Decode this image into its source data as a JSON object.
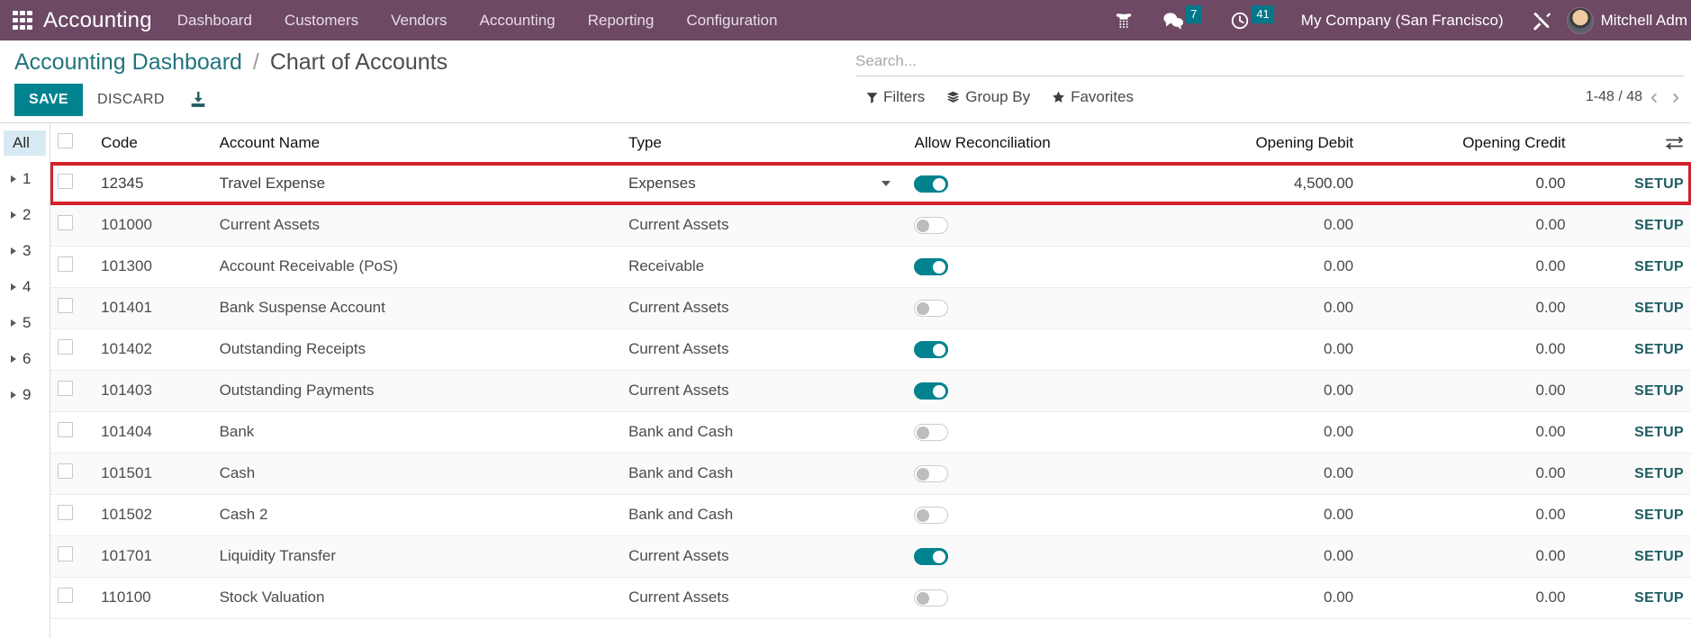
{
  "navbar": {
    "apps_icon": "apps-grid-icon",
    "brand": "Accounting",
    "menus": [
      "Dashboard",
      "Customers",
      "Vendors",
      "Accounting",
      "Reporting",
      "Configuration"
    ],
    "icons": [
      {
        "name": "voip-dialpad-icon",
        "badge": null
      },
      {
        "name": "messaging-chat-icon",
        "badge": "7"
      },
      {
        "name": "activities-clock-icon",
        "badge": "41"
      }
    ],
    "company": "My Company (San Francisco)",
    "debug_icon": "tools-wrench-icon",
    "user_name": "Mitchell Adm",
    "avatar": "user-avatar"
  },
  "control_panel": {
    "breadcrumb_root": "Accounting Dashboard",
    "breadcrumb_sep": "/",
    "breadcrumb_current": "Chart of Accounts",
    "save_label": "SAVE",
    "discard_label": "DISCARD",
    "import_icon": "import-download-icon"
  },
  "search": {
    "placeholder": "Search...",
    "value": "",
    "filters_label": "Filters",
    "group_by_label": "Group By",
    "favorites_label": "Favorites",
    "filters_icon": "funnel-icon",
    "group_by_icon": "layers-icon",
    "favorites_icon": "star-icon",
    "pager_text": "1-48 / 48",
    "prev_icon": "chevron-left-icon",
    "next_icon": "chevron-right-icon"
  },
  "sidebar": {
    "all_label": "All",
    "nodes": [
      "1",
      "2",
      "3",
      "4",
      "5",
      "6",
      "9"
    ]
  },
  "table": {
    "headers": {
      "code": "Code",
      "name": "Account Name",
      "type": "Type",
      "recon": "Allow Reconciliation",
      "debit": "Opening Debit",
      "credit": "Opening Credit"
    },
    "optional_columns_icon": "column-options-icon",
    "setup_label": "SETUP",
    "rows": [
      {
        "code": "12345",
        "name": "Travel Expense",
        "type": "Expenses",
        "recon": true,
        "debit": "4,500.00",
        "credit": "0.00",
        "editing": true
      },
      {
        "code": "101000",
        "name": "Current Assets",
        "type": "Current Assets",
        "recon": false,
        "debit": "0.00",
        "credit": "0.00",
        "editing": false
      },
      {
        "code": "101300",
        "name": "Account Receivable (PoS)",
        "type": "Receivable",
        "recon": true,
        "debit": "0.00",
        "credit": "0.00",
        "editing": false
      },
      {
        "code": "101401",
        "name": "Bank Suspense Account",
        "type": "Current Assets",
        "recon": false,
        "debit": "0.00",
        "credit": "0.00",
        "editing": false
      },
      {
        "code": "101402",
        "name": "Outstanding Receipts",
        "type": "Current Assets",
        "recon": true,
        "debit": "0.00",
        "credit": "0.00",
        "editing": false
      },
      {
        "code": "101403",
        "name": "Outstanding Payments",
        "type": "Current Assets",
        "recon": true,
        "debit": "0.00",
        "credit": "0.00",
        "editing": false
      },
      {
        "code": "101404",
        "name": "Bank",
        "type": "Bank and Cash",
        "recon": false,
        "debit": "0.00",
        "credit": "0.00",
        "editing": false
      },
      {
        "code": "101501",
        "name": "Cash",
        "type": "Bank and Cash",
        "recon": false,
        "debit": "0.00",
        "credit": "0.00",
        "editing": false
      },
      {
        "code": "101502",
        "name": "Cash 2",
        "type": "Bank and Cash",
        "recon": false,
        "debit": "0.00",
        "credit": "0.00",
        "editing": false
      },
      {
        "code": "101701",
        "name": "Liquidity Transfer",
        "type": "Current Assets",
        "recon": true,
        "debit": "0.00",
        "credit": "0.00",
        "editing": false
      },
      {
        "code": "110100",
        "name": "Stock Valuation",
        "type": "Current Assets",
        "recon": false,
        "debit": "0.00",
        "credit": "0.00",
        "editing": false
      }
    ]
  },
  "colors": {
    "navbar": "#6d4964",
    "accent": "#00828f",
    "link": "#21747e",
    "highlight": "#d0222b",
    "badge": "#00788a"
  }
}
